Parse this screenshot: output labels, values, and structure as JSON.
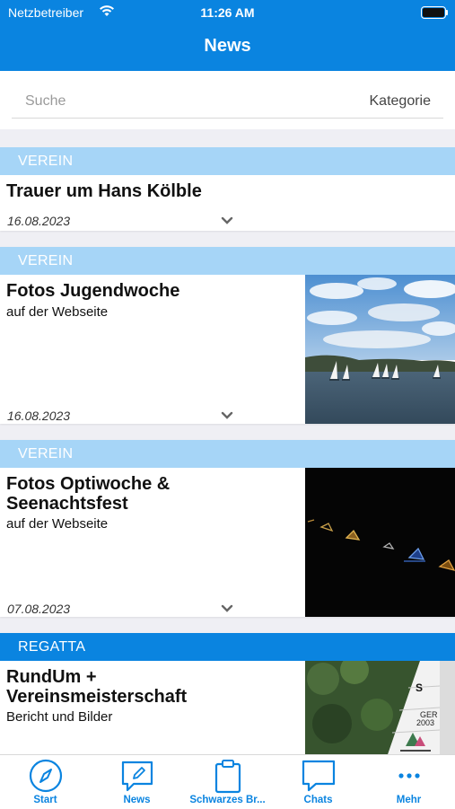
{
  "status": {
    "carrier": "Netzbetreiber",
    "time": "11:26 AM"
  },
  "nav": {
    "title": "News"
  },
  "search": {
    "placeholder": "Suche",
    "category_label": "Kategorie"
  },
  "colors": {
    "accent": "#0a84e0",
    "category_light": "#a6d5f7",
    "category_regatta": "#0a84e0"
  },
  "news": [
    {
      "category": "VEREIN",
      "title": "Trauer um Hans Kölble",
      "date": "16.08.2023"
    },
    {
      "category": "VEREIN",
      "title": "Fotos Jugendwoche",
      "subtitle": "auf der Webseite",
      "date": "16.08.2023",
      "image": "sailing-lake-photo"
    },
    {
      "category": "VEREIN",
      "title": "Fotos Optiwoche & Seenachtsfest",
      "subtitle": "auf der Webseite",
      "date": "07.08.2023",
      "image": "night-lights-photo"
    },
    {
      "category": "REGATTA",
      "title": "RundUm + Vereinsmeisterschaft",
      "subtitle": "Bericht und Bilder",
      "image": "sail-closeup-photo"
    }
  ],
  "tabs": [
    {
      "label": "Start",
      "icon": "compass-icon"
    },
    {
      "label": "News",
      "icon": "news-edit-icon"
    },
    {
      "label": "Schwarzes Br...",
      "icon": "clipboard-icon"
    },
    {
      "label": "Chats",
      "icon": "chat-bubble-icon"
    },
    {
      "label": "Mehr",
      "icon": "more-dots-icon"
    }
  ]
}
